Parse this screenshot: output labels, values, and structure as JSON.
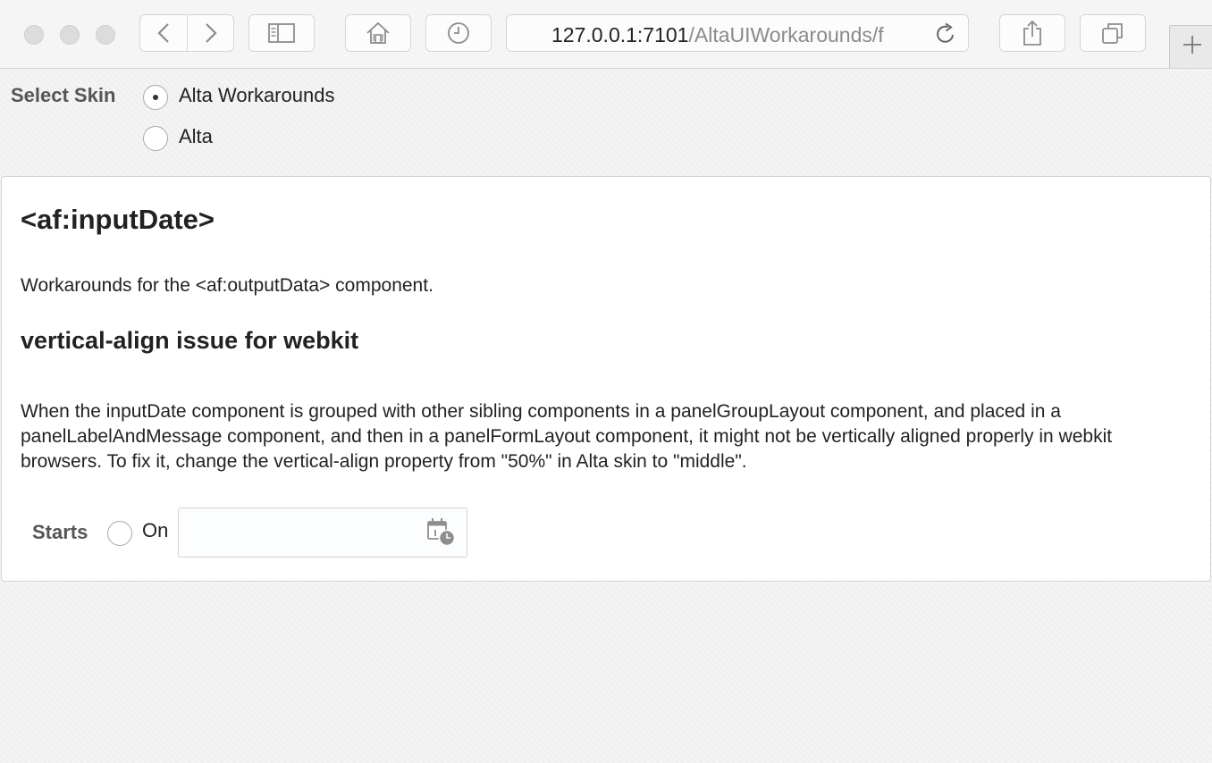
{
  "browser": {
    "url_host": "127.0.0.1:7101",
    "url_path": "/AltaUIWorkarounds/f",
    "icons": {
      "back": "chevron-left-icon",
      "forward": "chevron-right-icon",
      "sidebar": "sidebar-icon",
      "home": "home-icon",
      "history": "clock-icon",
      "reload": "reload-icon",
      "share": "share-icon",
      "tabs": "tabs-icon",
      "new_tab": "plus-icon"
    }
  },
  "skin": {
    "label": "Select Skin",
    "options": [
      {
        "label": "Alta Workarounds",
        "selected": true
      },
      {
        "label": "Alta",
        "selected": false
      }
    ]
  },
  "content": {
    "title": "<af:inputDate>",
    "intro": "Workarounds for the <af:outputData> component.",
    "section_title": "vertical-align issue for webkit",
    "section_body": "When the inputDate component is grouped with other sibling components in a panelGroupLayout component, and placed in a panelLabelAndMessage component, and then in a panelFormLayout component, it might not be vertically aligned properly in webkit browsers. To fix it, change the vertical-align property from \"50%\" in Alta skin to \"middle\".",
    "form": {
      "label": "Starts",
      "radio_label": "On",
      "radio_selected": false,
      "date_value": "",
      "date_icon": "calendar-clock-icon"
    }
  }
}
